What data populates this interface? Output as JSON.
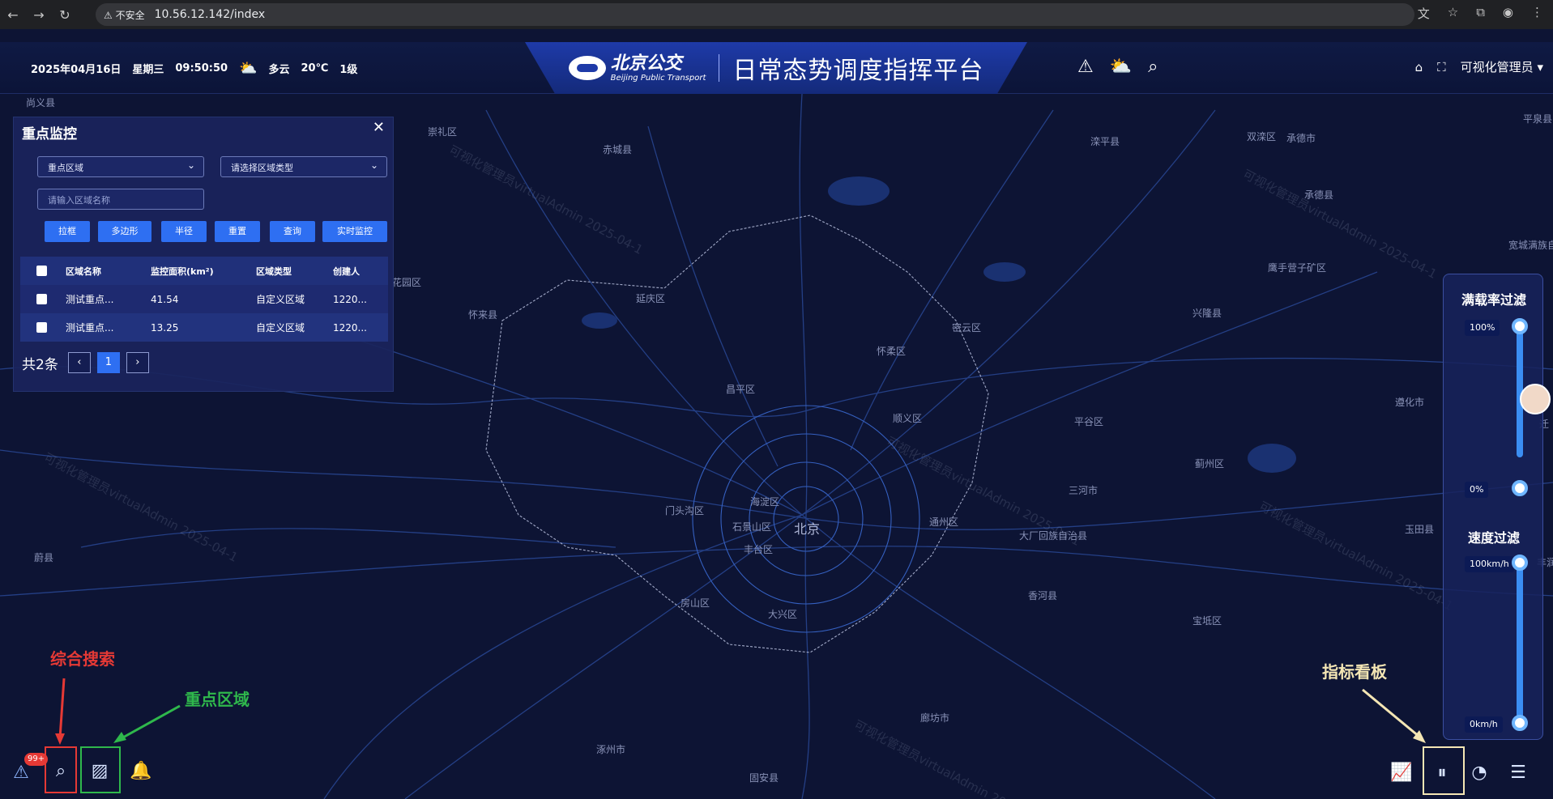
{
  "browser": {
    "security_label": "不安全",
    "url": "10.56.12.142/index"
  },
  "header": {
    "date": "2025年04月16日",
    "weekday": "星期三",
    "time": "09:50:50",
    "weather": "多云",
    "temperature": "20℃",
    "wind": "1级",
    "logo_cn": "北京公交",
    "logo_en": "Beijing Public Transport",
    "platform_title": "日常态势调度指挥平台",
    "user": "可视化管理员"
  },
  "panel": {
    "title": "重点监控",
    "area_select": "重点区域",
    "type_select_placeholder": "请选择区域类型",
    "name_input_placeholder": "请输入区域名称",
    "buttons": [
      "拉框",
      "多边形",
      "半径",
      "重置",
      "查询",
      "实时监控"
    ],
    "columns": [
      "区域名称",
      "监控面积(km²)",
      "区域类型",
      "创建人"
    ],
    "rows": [
      {
        "name": "测试重点...",
        "area": "41.54",
        "type": "自定义区域",
        "creator": "1220..."
      },
      {
        "name": "测试重点...",
        "area": "13.25",
        "type": "自定义区域",
        "creator": "1220..."
      }
    ],
    "total": "共2条",
    "page": "1"
  },
  "filters": {
    "load_title": "满载率过滤",
    "load_max": "100%",
    "load_min": "0%",
    "speed_title": "速度过滤",
    "speed_max": "100km/h",
    "speed_min": "0km/h"
  },
  "annotations": {
    "search": "综合搜索",
    "key_area": "重点区域",
    "dashboard": "指标看板"
  },
  "alarm_badge": "99+",
  "map_places": [
    {
      "name": "尚义县"
    },
    {
      "name": "崇礼区"
    },
    {
      "name": "赤城县"
    },
    {
      "name": "滦平县"
    },
    {
      "name": "双滦区"
    },
    {
      "name": "承德市"
    },
    {
      "name": "平泉县"
    },
    {
      "name": "承德县"
    },
    {
      "name": "宽城满族自治县"
    },
    {
      "name": "鹰手营子矿区"
    },
    {
      "name": "花园区"
    },
    {
      "name": "延庆区"
    },
    {
      "name": "怀来县"
    },
    {
      "name": "兴隆县"
    },
    {
      "name": "密云区"
    },
    {
      "name": "怀柔区"
    },
    {
      "name": "昌平区"
    },
    {
      "name": "顺义区"
    },
    {
      "name": "平谷区"
    },
    {
      "name": "遵化市"
    },
    {
      "name": "蓟州区"
    },
    {
      "name": "三河市"
    },
    {
      "name": "海淀区"
    },
    {
      "name": "门头沟区"
    },
    {
      "name": "石景山区"
    },
    {
      "name": "北京"
    },
    {
      "name": "通州区"
    },
    {
      "name": "丰台区"
    },
    {
      "name": "大厂回族自治县"
    },
    {
      "name": "玉田县"
    },
    {
      "name": "丰润"
    },
    {
      "name": "蔚县"
    },
    {
      "name": "房山区"
    },
    {
      "name": "大兴区"
    },
    {
      "name": "香河县"
    },
    {
      "name": "宝坻区"
    },
    {
      "name": "廊坊市"
    },
    {
      "name": "涿州市"
    },
    {
      "name": "固安县"
    },
    {
      "name": "迁"
    }
  ],
  "watermark": "可视化管理员virtualAdmin 2025-04-1"
}
